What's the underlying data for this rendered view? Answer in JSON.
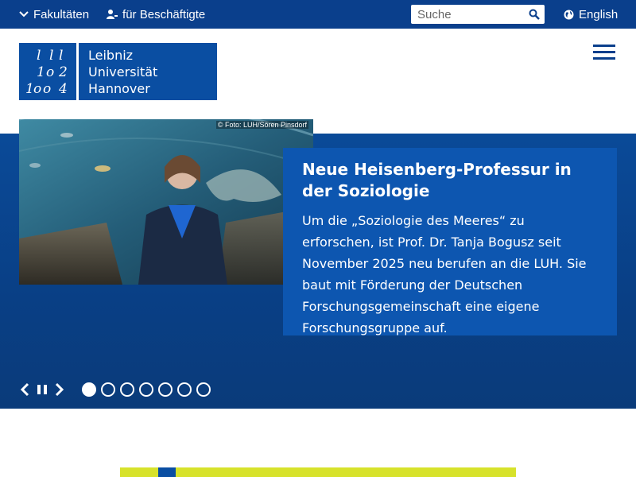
{
  "topbar": {
    "faculties_label": "Fakultäten",
    "staff_label": "für Beschäftigte",
    "search_placeholder": "Suche",
    "language_label": "English"
  },
  "logo": {
    "mark_glyphs": [
      "l",
      "l",
      "l",
      "o",
      "2",
      "1",
      "o",
      "o",
      "4"
    ],
    "line1": "Leibniz",
    "line2": "Universität",
    "line3": "Hannover"
  },
  "slider": {
    "photo_credit": "© Foto: LUH/Sören Pinsdorf",
    "headline": "Neue Heisenberg-Professur in der Soziologie",
    "body": "Um die „Soziologie des Meeres“ zu erforschen, ist Prof. Dr. Tanja Bogusz seit November 2025 neu berufen an die LUH. Sie baut mit Förderung der Deutschen Forschungsgemeinschaft eine eigene Forschungsgruppe auf.",
    "slide_count": 7,
    "active_slide": 1
  },
  "colors": {
    "brand_blue": "#0a3f8c",
    "card_blue": "#0d56b0",
    "accent_yellow": "#d7e22b"
  }
}
